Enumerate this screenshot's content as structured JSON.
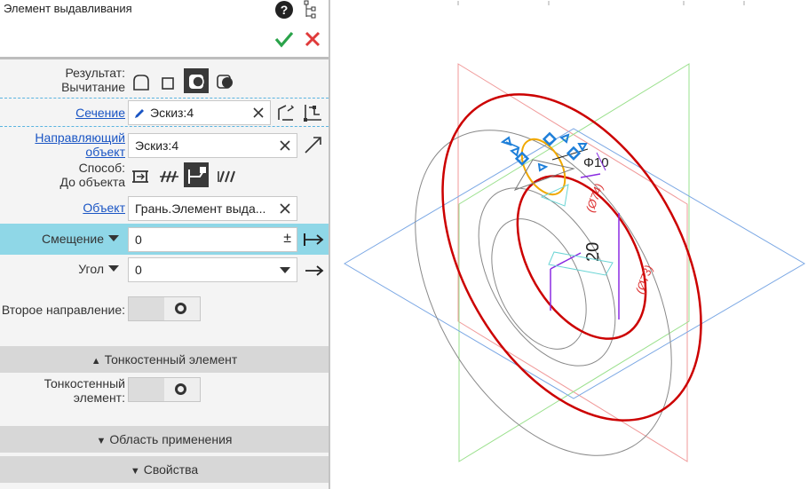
{
  "panel": {
    "title": "Элемент выдавливания",
    "result_label": "Результат:",
    "result_value": "Вычитание",
    "section_label": "Сечение",
    "section_value": "Эскиз:4",
    "guide_label_line1": "Направляющий",
    "guide_label_line2": "объект",
    "guide_value": "Эскиз:4",
    "method_label_line1": "Способ:",
    "method_label_line2": "До объекта",
    "object_label": "Объект",
    "object_value": "Грань.Элемент выда...",
    "offset_label": "Смещение",
    "offset_value": "0",
    "offset_pm": "±",
    "angle_label": "Угол",
    "angle_value": "0",
    "second_dir_label": "Второе направление:",
    "thin_wall_section": "Тонкостенный элемент",
    "thin_wall_label_line1": "Тонкостенный",
    "thin_wall_label_line2": "элемент:",
    "scope_section": "Область применения",
    "props_section": "Свойства"
  },
  "viewport": {
    "dim_diameter": "Φ10",
    "dim_height": "20",
    "dim_74": "(Ø74)",
    "dim_73": "(Ø73)"
  }
}
